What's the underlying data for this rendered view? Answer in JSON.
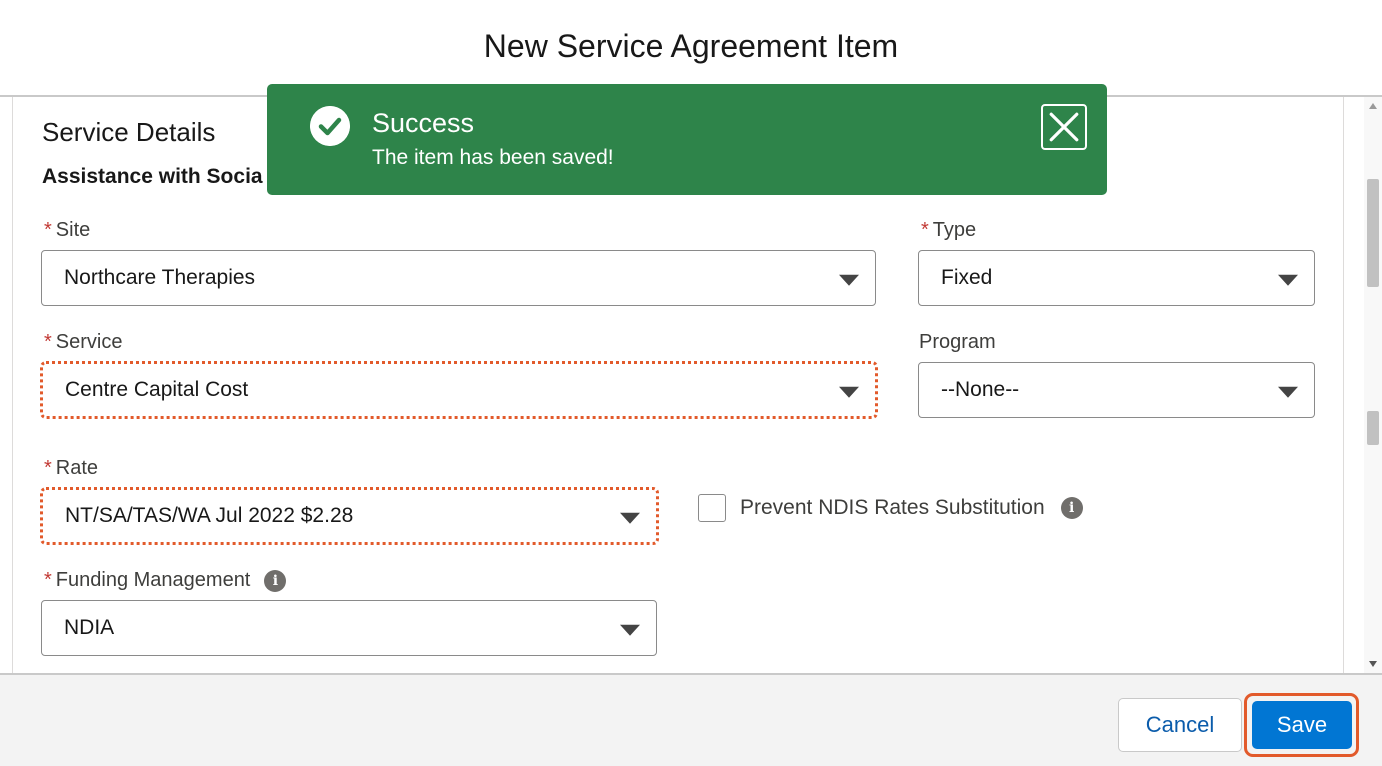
{
  "modal": {
    "title": "New Service Agreement Item"
  },
  "section": {
    "title": "Service Details",
    "subtitle": "Assistance with Socia"
  },
  "fields": {
    "site": {
      "label": "Site",
      "required": "*",
      "value": "Northcare Therapies"
    },
    "type": {
      "label": "Type",
      "required": "*",
      "value": "Fixed"
    },
    "service": {
      "label": "Service",
      "required": "*",
      "value": "Centre Capital Cost"
    },
    "program": {
      "label": "Program",
      "value": "--None--"
    },
    "rate": {
      "label": "Rate",
      "required": "*",
      "value": "NT/SA/TAS/WA Jul 2022 $2.28"
    },
    "prevent_ndis": {
      "label": "Prevent NDIS Rates Substitution",
      "checked": false
    },
    "funding_management": {
      "label": "Funding Management",
      "required": "*",
      "value": "NDIA"
    }
  },
  "toast": {
    "title": "Success",
    "message": "The item has been saved!",
    "color": "#2e844a"
  },
  "footer": {
    "cancel_label": "Cancel",
    "save_label": "Save"
  },
  "colors": {
    "brand": "#0176d3",
    "highlight": "#e25a2b",
    "required": "#c23934"
  },
  "icons": {
    "info": "i"
  }
}
